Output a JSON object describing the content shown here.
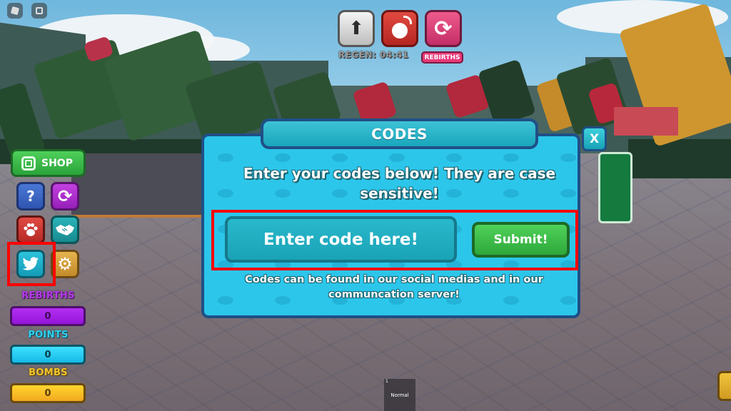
{
  "top_system": {
    "roblox_menu_icon": "roblox-logo-icon",
    "chat_icon": "chat-icon"
  },
  "top_hud": {
    "buttons": [
      {
        "name": "upgrade",
        "icon": "arrow-up-icon",
        "glyph": "⬆",
        "color": "#d8d8d8"
      },
      {
        "name": "bomb",
        "icon": "bomb-icon",
        "glyph": "💣",
        "color": "#d63a32"
      },
      {
        "name": "rebirth",
        "icon": "refresh-icon",
        "glyph": "⟳",
        "color": "#e0487e"
      }
    ],
    "regen_label": "REGEN: 04:41",
    "rebirths_button_label": "REBIRTHS"
  },
  "left_hud": {
    "shop_label": "SHOP",
    "buttons": [
      {
        "name": "help",
        "icon": "question-icon",
        "glyph": "?"
      },
      {
        "name": "rebirth",
        "icon": "refresh-icon",
        "glyph": "⟳"
      },
      {
        "name": "pets",
        "icon": "paw-icon",
        "glyph": "🐾"
      },
      {
        "name": "trade",
        "icon": "handshake-icon",
        "glyph": "🤝"
      },
      {
        "name": "twitter",
        "icon": "twitter-bird-icon",
        "glyph": "🐦"
      },
      {
        "name": "settings",
        "icon": "gear-icon",
        "glyph": "⚙"
      }
    ],
    "stats": [
      {
        "label": "REBIRTHS",
        "value": "0",
        "color": "#a622ea"
      },
      {
        "label": "POINTS",
        "value": "0",
        "color": "#2ccff5"
      },
      {
        "label": "BOMBS",
        "value": "0",
        "color": "#f8be26"
      }
    ]
  },
  "codes_modal": {
    "title": "CODES",
    "close_label": "X",
    "heading": "Enter your codes below! They are case sensitive!",
    "input_placeholder": "Enter code here!",
    "input_value": "",
    "submit_label": "Submit!",
    "footer": "Codes can be found in our social medias and in our communcation server!"
  },
  "hotbar": {
    "slot_number": "1",
    "slot_label": "Normal"
  },
  "annotations": {
    "highlight_color": "#ff0000"
  }
}
